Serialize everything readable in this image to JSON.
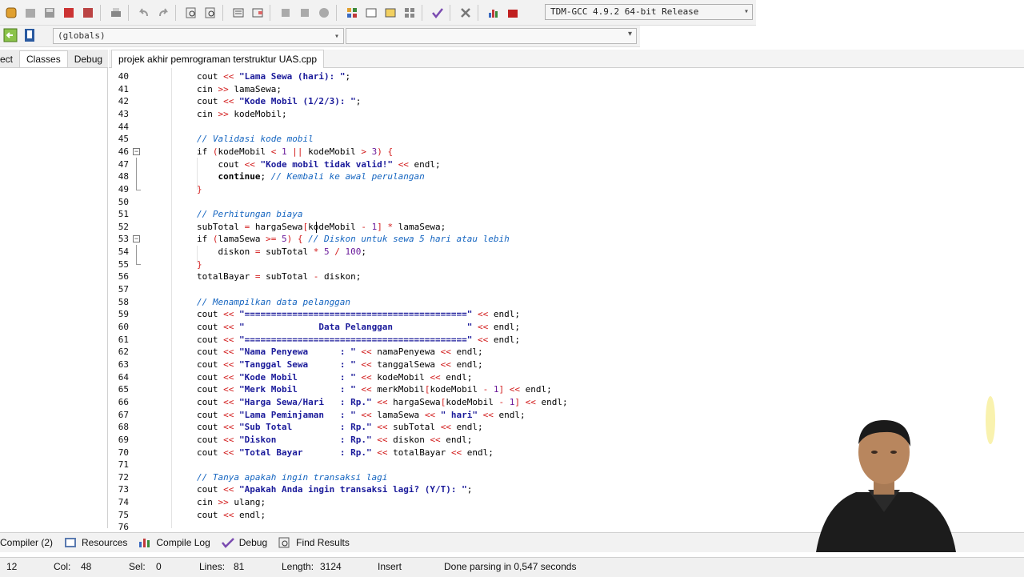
{
  "toolbar": {
    "compiler_select": "TDM-GCC 4.9.2 64-bit Release",
    "globals_select": "(globals)"
  },
  "left_panel": {
    "tabs": [
      "ect",
      "Classes",
      "Debug"
    ]
  },
  "editor": {
    "tab_title": "projek akhir pemrograman terstruktur UAS.cpp",
    "lines": [
      {
        "n": "40",
        "segs": [
          [
            "cout ",
            ""
          ],
          [
            "<<",
            "op"
          ],
          [
            " ",
            ""
          ],
          [
            "\"Lama Sewa (hari): \"",
            "str"
          ],
          [
            ";",
            ""
          ]
        ]
      },
      {
        "n": "41",
        "segs": [
          [
            "cin ",
            ""
          ],
          [
            ">>",
            "op"
          ],
          [
            " lamaSewa;",
            ""
          ]
        ]
      },
      {
        "n": "42",
        "segs": [
          [
            "cout ",
            ""
          ],
          [
            "<<",
            "op"
          ],
          [
            " ",
            ""
          ],
          [
            "\"Kode Mobil (1/2/3): \"",
            "str"
          ],
          [
            ";",
            ""
          ]
        ]
      },
      {
        "n": "43",
        "segs": [
          [
            "cin ",
            ""
          ],
          [
            ">>",
            "op"
          ],
          [
            " kodeMobil;",
            ""
          ]
        ]
      },
      {
        "n": "44",
        "segs": []
      },
      {
        "n": "45",
        "segs": [
          [
            "// Validasi kode mobil",
            "cm"
          ]
        ]
      },
      {
        "n": "46",
        "segs": [
          [
            "if ",
            ""
          ],
          [
            "(",
            "op"
          ],
          [
            "kodeMobil ",
            ""
          ],
          [
            "<",
            "op"
          ],
          [
            " ",
            ""
          ],
          [
            "1",
            "num"
          ],
          [
            " ",
            ""
          ],
          [
            "||",
            "op"
          ],
          [
            " kodeMobil ",
            ""
          ],
          [
            ">",
            "op"
          ],
          [
            " ",
            ""
          ],
          [
            "3",
            "num"
          ],
          [
            ")",
            "op"
          ],
          [
            " ",
            ""
          ],
          [
            "{",
            "op"
          ]
        ]
      },
      {
        "n": "47",
        "segs": [
          [
            "    cout ",
            ""
          ],
          [
            "<<",
            "op"
          ],
          [
            " ",
            ""
          ],
          [
            "\"Kode mobil tidak valid!\"",
            "str"
          ],
          [
            " ",
            ""
          ],
          [
            "<<",
            "op"
          ],
          [
            " endl;",
            ""
          ]
        ]
      },
      {
        "n": "48",
        "segs": [
          [
            "    ",
            ""
          ],
          [
            "continue",
            "kw"
          ],
          [
            "; ",
            ""
          ],
          [
            "// Kembali ke awal perulangan",
            "cm"
          ]
        ]
      },
      {
        "n": "49",
        "segs": [
          [
            "}",
            "op"
          ]
        ]
      },
      {
        "n": "50",
        "segs": []
      },
      {
        "n": "51",
        "segs": [
          [
            "// Perhitungan biaya",
            "cm"
          ]
        ]
      },
      {
        "n": "52",
        "segs": [
          [
            "subTotal ",
            ""
          ],
          [
            "=",
            "op"
          ],
          [
            " hargaSewa",
            ""
          ],
          [
            "[",
            "op"
          ],
          [
            "kodeMobil ",
            ""
          ],
          [
            "-",
            "op"
          ],
          [
            " ",
            ""
          ],
          [
            "1",
            "num"
          ],
          [
            "]",
            "op"
          ],
          [
            " ",
            ""
          ],
          [
            "*",
            "op"
          ],
          [
            " lamaSewa;",
            ""
          ]
        ]
      },
      {
        "n": "53",
        "segs": [
          [
            "if ",
            ""
          ],
          [
            "(",
            "op"
          ],
          [
            "lamaSewa ",
            ""
          ],
          [
            ">=",
            "op"
          ],
          [
            " ",
            ""
          ],
          [
            "5",
            "num"
          ],
          [
            ")",
            "op"
          ],
          [
            " ",
            ""
          ],
          [
            "{",
            "op"
          ],
          [
            " ",
            ""
          ],
          [
            "// Diskon untuk sewa 5 hari atau lebih",
            "cm"
          ]
        ]
      },
      {
        "n": "54",
        "segs": [
          [
            "    diskon ",
            ""
          ],
          [
            "=",
            "op"
          ],
          [
            " subTotal ",
            ""
          ],
          [
            "*",
            "op"
          ],
          [
            " ",
            ""
          ],
          [
            "5",
            "num"
          ],
          [
            " ",
            ""
          ],
          [
            "/",
            "op"
          ],
          [
            " ",
            ""
          ],
          [
            "100",
            "num"
          ],
          [
            ";",
            ""
          ]
        ]
      },
      {
        "n": "55",
        "segs": [
          [
            "}",
            "op"
          ]
        ]
      },
      {
        "n": "56",
        "segs": [
          [
            "totalBayar ",
            ""
          ],
          [
            "=",
            "op"
          ],
          [
            " subTotal ",
            ""
          ],
          [
            "-",
            "op"
          ],
          [
            " diskon;",
            ""
          ]
        ]
      },
      {
        "n": "57",
        "segs": []
      },
      {
        "n": "58",
        "segs": [
          [
            "// Menampilkan data pelanggan",
            "cm"
          ]
        ]
      },
      {
        "n": "59",
        "segs": [
          [
            "cout ",
            ""
          ],
          [
            "<<",
            "op"
          ],
          [
            " ",
            ""
          ],
          [
            "\"==========================================\"",
            "str"
          ],
          [
            " ",
            ""
          ],
          [
            "<<",
            "op"
          ],
          [
            " endl;",
            ""
          ]
        ]
      },
      {
        "n": "60",
        "segs": [
          [
            "cout ",
            ""
          ],
          [
            "<<",
            "op"
          ],
          [
            " ",
            ""
          ],
          [
            "\"              Data Pelanggan              \"",
            "str"
          ],
          [
            " ",
            ""
          ],
          [
            "<<",
            "op"
          ],
          [
            " endl;",
            ""
          ]
        ]
      },
      {
        "n": "61",
        "segs": [
          [
            "cout ",
            ""
          ],
          [
            "<<",
            "op"
          ],
          [
            " ",
            ""
          ],
          [
            "\"==========================================\"",
            "str"
          ],
          [
            " ",
            ""
          ],
          [
            "<<",
            "op"
          ],
          [
            " endl;",
            ""
          ]
        ]
      },
      {
        "n": "62",
        "segs": [
          [
            "cout ",
            ""
          ],
          [
            "<<",
            "op"
          ],
          [
            " ",
            ""
          ],
          [
            "\"Nama Penyewa      : \"",
            "str"
          ],
          [
            " ",
            ""
          ],
          [
            "<<",
            "op"
          ],
          [
            " namaPenyewa ",
            ""
          ],
          [
            "<<",
            "op"
          ],
          [
            " endl;",
            ""
          ]
        ]
      },
      {
        "n": "63",
        "segs": [
          [
            "cout ",
            ""
          ],
          [
            "<<",
            "op"
          ],
          [
            " ",
            ""
          ],
          [
            "\"Tanggal Sewa      : \"",
            "str"
          ],
          [
            " ",
            ""
          ],
          [
            "<<",
            "op"
          ],
          [
            " tanggalSewa ",
            ""
          ],
          [
            "<<",
            "op"
          ],
          [
            " endl;",
            ""
          ]
        ]
      },
      {
        "n": "64",
        "segs": [
          [
            "cout ",
            ""
          ],
          [
            "<<",
            "op"
          ],
          [
            " ",
            ""
          ],
          [
            "\"Kode Mobil        : \"",
            "str"
          ],
          [
            " ",
            ""
          ],
          [
            "<<",
            "op"
          ],
          [
            " kodeMobil ",
            ""
          ],
          [
            "<<",
            "op"
          ],
          [
            " endl;",
            ""
          ]
        ]
      },
      {
        "n": "65",
        "segs": [
          [
            "cout ",
            ""
          ],
          [
            "<<",
            "op"
          ],
          [
            " ",
            ""
          ],
          [
            "\"Merk Mobil        : \"",
            "str"
          ],
          [
            " ",
            ""
          ],
          [
            "<<",
            "op"
          ],
          [
            " merkMobil",
            ""
          ],
          [
            "[",
            "op"
          ],
          [
            "kodeMobil ",
            ""
          ],
          [
            "-",
            "op"
          ],
          [
            " ",
            ""
          ],
          [
            "1",
            "num"
          ],
          [
            "]",
            "op"
          ],
          [
            " ",
            ""
          ],
          [
            "<<",
            "op"
          ],
          [
            " endl;",
            ""
          ]
        ]
      },
      {
        "n": "66",
        "segs": [
          [
            "cout ",
            ""
          ],
          [
            "<<",
            "op"
          ],
          [
            " ",
            ""
          ],
          [
            "\"Harga Sewa/Hari   : Rp.\"",
            "str"
          ],
          [
            " ",
            ""
          ],
          [
            "<<",
            "op"
          ],
          [
            " hargaSewa",
            ""
          ],
          [
            "[",
            "op"
          ],
          [
            "kodeMobil ",
            ""
          ],
          [
            "-",
            "op"
          ],
          [
            " ",
            ""
          ],
          [
            "1",
            "num"
          ],
          [
            "]",
            "op"
          ],
          [
            " ",
            ""
          ],
          [
            "<<",
            "op"
          ],
          [
            " endl;",
            ""
          ]
        ]
      },
      {
        "n": "67",
        "segs": [
          [
            "cout ",
            ""
          ],
          [
            "<<",
            "op"
          ],
          [
            " ",
            ""
          ],
          [
            "\"Lama Peminjaman   : \"",
            "str"
          ],
          [
            " ",
            ""
          ],
          [
            "<<",
            "op"
          ],
          [
            " lamaSewa ",
            ""
          ],
          [
            "<<",
            "op"
          ],
          [
            " ",
            ""
          ],
          [
            "\" hari\"",
            "str"
          ],
          [
            " ",
            ""
          ],
          [
            "<<",
            "op"
          ],
          [
            " endl;",
            ""
          ]
        ]
      },
      {
        "n": "68",
        "segs": [
          [
            "cout ",
            ""
          ],
          [
            "<<",
            "op"
          ],
          [
            " ",
            ""
          ],
          [
            "\"Sub Total         : Rp.\"",
            "str"
          ],
          [
            " ",
            ""
          ],
          [
            "<<",
            "op"
          ],
          [
            " subTotal ",
            ""
          ],
          [
            "<<",
            "op"
          ],
          [
            " endl;",
            ""
          ]
        ]
      },
      {
        "n": "69",
        "segs": [
          [
            "cout ",
            ""
          ],
          [
            "<<",
            "op"
          ],
          [
            " ",
            ""
          ],
          [
            "\"Diskon            : Rp.\"",
            "str"
          ],
          [
            " ",
            ""
          ],
          [
            "<<",
            "op"
          ],
          [
            " diskon ",
            ""
          ],
          [
            "<<",
            "op"
          ],
          [
            " endl;",
            ""
          ]
        ]
      },
      {
        "n": "70",
        "segs": [
          [
            "cout ",
            ""
          ],
          [
            "<<",
            "op"
          ],
          [
            " ",
            ""
          ],
          [
            "\"Total Bayar       : Rp.\"",
            "str"
          ],
          [
            " ",
            ""
          ],
          [
            "<<",
            "op"
          ],
          [
            " totalBayar ",
            ""
          ],
          [
            "<<",
            "op"
          ],
          [
            " endl;",
            ""
          ]
        ]
      },
      {
        "n": "71",
        "segs": []
      },
      {
        "n": "72",
        "segs": [
          [
            "// Tanya apakah ingin transaksi lagi",
            "cm"
          ]
        ]
      },
      {
        "n": "73",
        "segs": [
          [
            "cout ",
            ""
          ],
          [
            "<<",
            "op"
          ],
          [
            " ",
            ""
          ],
          [
            "\"Apakah Anda ingin transaksi lagi? (Y/T): \"",
            "str"
          ],
          [
            ";",
            ""
          ]
        ]
      },
      {
        "n": "74",
        "segs": [
          [
            "cin ",
            ""
          ],
          [
            ">>",
            "op"
          ],
          [
            " ulang;",
            ""
          ]
        ]
      },
      {
        "n": "75",
        "segs": [
          [
            "cout ",
            ""
          ],
          [
            "<<",
            "op"
          ],
          [
            " endl;",
            ""
          ]
        ]
      },
      {
        "n": "76",
        "segs": []
      }
    ]
  },
  "bottom_tabs": [
    "Compiler (2)",
    "Resources",
    "Compile Log",
    "Debug",
    "Find Results"
  ],
  "status": {
    "line_num": "12",
    "col_label": "Col:",
    "col_value": "48",
    "sel_label": "Sel:",
    "sel_value": "0",
    "lines_label": "Lines:",
    "lines_value": "81",
    "length_label": "Length:",
    "length_value": "3124",
    "mode": "Insert",
    "message": "Done parsing in 0,547 seconds"
  }
}
